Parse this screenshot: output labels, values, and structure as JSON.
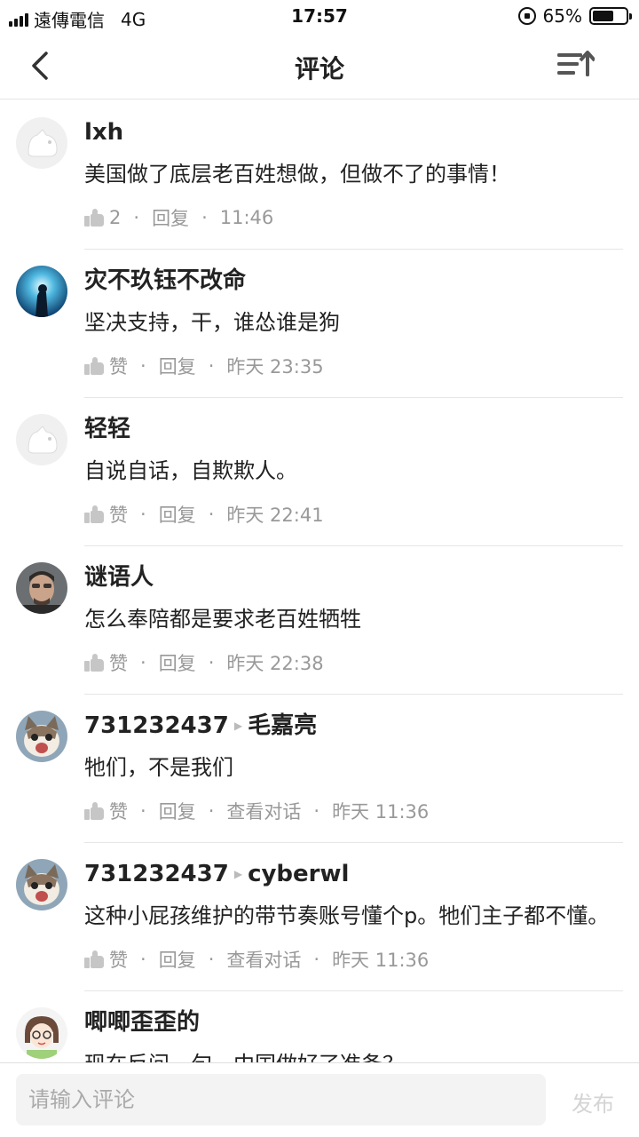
{
  "status_bar": {
    "carrier": "遠傳電信",
    "network": "4G",
    "time": "17:57",
    "battery": "65%",
    "battery_level": 0.65
  },
  "header": {
    "title": "评论"
  },
  "comments": [
    {
      "user": "lxh",
      "reply_to": "",
      "text": "美国做了底层老百姓想做，但做不了的事情！",
      "likes": "2",
      "reply": "回复",
      "view_thread": "",
      "time": "11:46",
      "avatar": "default-avatar"
    },
    {
      "user": "灾不玖钰不改命",
      "reply_to": "",
      "text": "坚决支持，干，谁怂谁是狗",
      "likes": "赞",
      "reply": "回复",
      "view_thread": "",
      "time": "昨天 23:35",
      "avatar": "blue-photo-avatar"
    },
    {
      "user": "轻轻",
      "reply_to": "",
      "text": "自说自话，自欺欺人。",
      "likes": "赞",
      "reply": "回复",
      "view_thread": "",
      "time": "昨天 22:41",
      "avatar": "default-avatar"
    },
    {
      "user": "谜语人",
      "reply_to": "",
      "text": "怎么奉陪都是要求老百姓牺牲",
      "likes": "赞",
      "reply": "回复",
      "view_thread": "",
      "time": "昨天 22:38",
      "avatar": "man-photo-avatar"
    },
    {
      "user": "731232437",
      "reply_to": "毛嘉亮",
      "text": "牠们，不是我们",
      "likes": "赞",
      "reply": "回复",
      "view_thread": "查看对话",
      "time": "昨天 11:36",
      "avatar": "cat-avatar"
    },
    {
      "user": "731232437",
      "reply_to": "cyberwl",
      "text": "这种小屁孩维护的带节奏账号懂个p。牠们主子都不懂。",
      "likes": "赞",
      "reply": "回复",
      "view_thread": "查看对话",
      "time": "昨天 11:36",
      "avatar": "cat-avatar"
    },
    {
      "user": "唧唧歪歪的",
      "reply_to": "",
      "text": "现在反问一句，中国做好了准备？",
      "likes": "",
      "reply": "",
      "view_thread": "",
      "time": "",
      "avatar": "cartoon-girl-avatar"
    }
  ],
  "input": {
    "placeholder": "请输入评论",
    "send_label": "发布"
  },
  "colors": {
    "text": "#222222",
    "meta": "#999999",
    "divider": "#e6e6e6",
    "send_disabled": "#d4d4d4"
  }
}
